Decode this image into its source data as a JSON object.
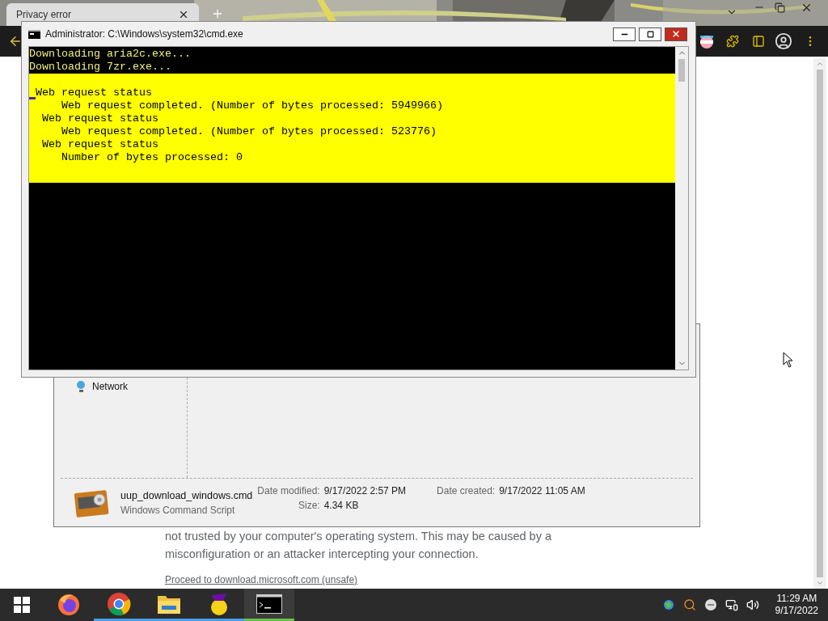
{
  "browser": {
    "tab": {
      "title": "Privacy error",
      "selected": true
    },
    "page": {
      "lines": [
        "not trusted by your computer's operating system. This may be caused by a",
        "misconfiguration or an attacker intercepting your connection."
      ],
      "link": "Proceed to download.microsoft.com (unsafe)"
    }
  },
  "explorer": {
    "nav_items": [
      {
        "label": "Network"
      }
    ],
    "details": {
      "name": "uup_download_windows.cmd",
      "type": "Windows Command Script",
      "fields": [
        {
          "label": "Date modified:",
          "value": "9/17/2022 2:57 PM"
        },
        {
          "label": "Size:",
          "value": "4.34 KB"
        },
        {
          "label": "Date created:",
          "value": "9/17/2022 11:05 AM"
        }
      ]
    }
  },
  "console": {
    "title": "Administrator: C:\\Windows\\system32\\cmd.exe",
    "lines": [
      {
        "text": "Downloading aria2c.exe...",
        "highlighted": false
      },
      {
        "text": "Downloading 7zr.exe...",
        "highlighted": false
      },
      {
        "text": "Web request status",
        "highlighted": true,
        "cursor": true
      },
      {
        "text": "    Web request completed. (Number of bytes processed: 5949966)",
        "highlighted": true,
        "cursor": false
      },
      {
        "text": " Web request status",
        "highlighted": true,
        "cursor": false
      },
      {
        "text": "    Web request completed. (Number of bytes processed: 523776)",
        "highlighted": true,
        "cursor": false
      },
      {
        "text": " Web request status",
        "highlighted": true,
        "cursor": false
      },
      {
        "text": "    Number of bytes processed: 0",
        "highlighted": true,
        "cursor": false
      }
    ]
  },
  "taskbar": {
    "apps": [
      {
        "kind": "firefox",
        "running": false,
        "active": false
      },
      {
        "kind": "chrome",
        "running": true,
        "active": false
      },
      {
        "kind": "folder",
        "running": true,
        "active": false
      },
      {
        "kind": "messenger",
        "running": true,
        "active": false
      },
      {
        "kind": "terminal",
        "running": true,
        "active": true
      }
    ],
    "time": "11:29 AM",
    "date": "9/17/2022"
  }
}
